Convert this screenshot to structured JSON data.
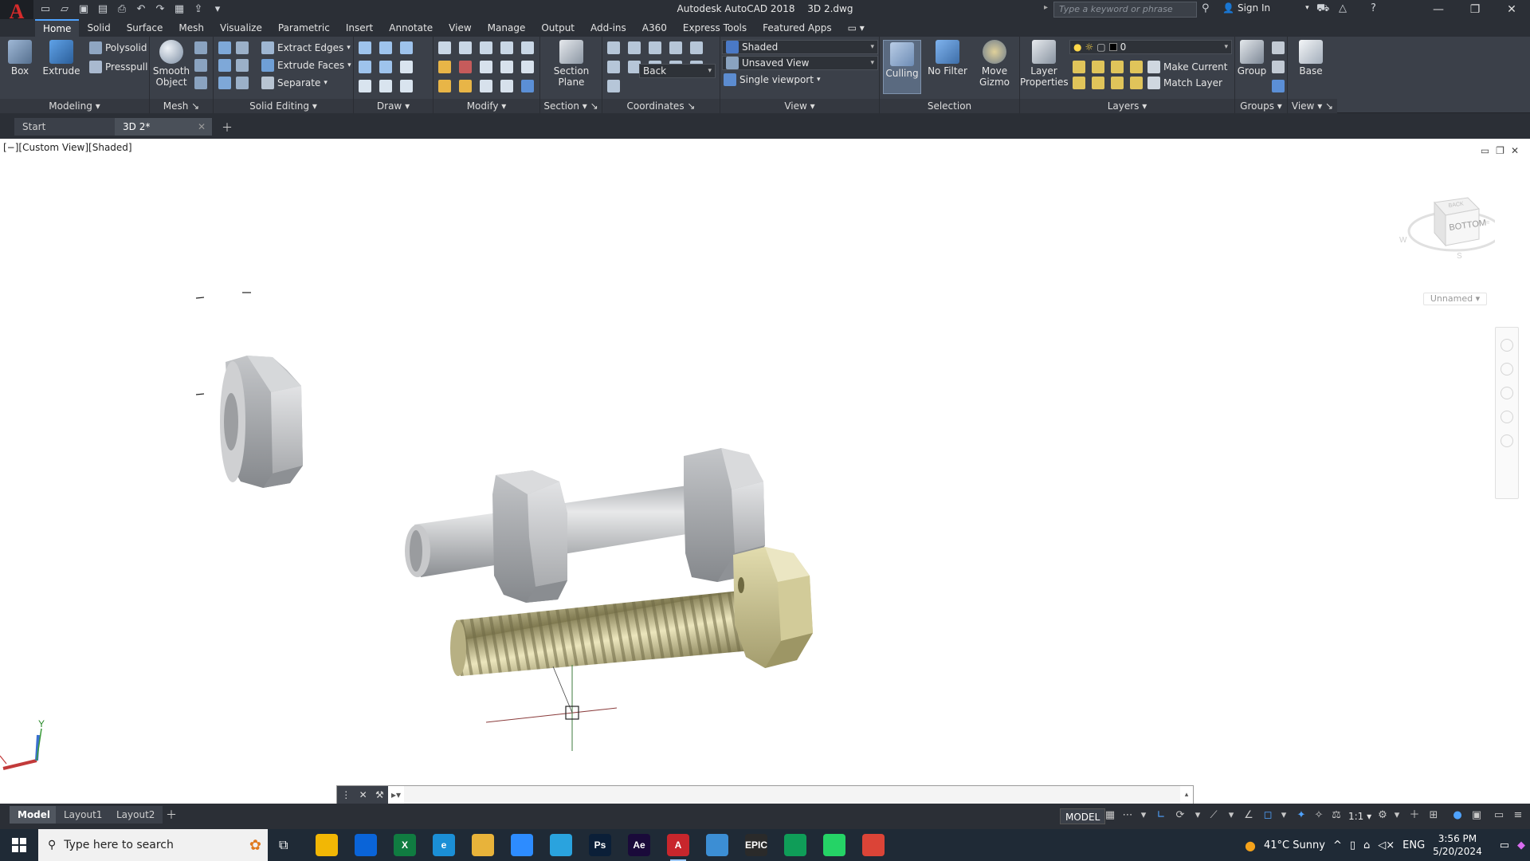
{
  "window": {
    "app_name": "Autodesk AutoCAD 2018",
    "file_name": "3D 2.dwg",
    "search_placeholder": "Type a keyword or phrase",
    "sign_in": "Sign In"
  },
  "ribbon_tabs": [
    "Home",
    "Solid",
    "Surface",
    "Mesh",
    "Visualize",
    "Parametric",
    "Insert",
    "Annotate",
    "View",
    "Manage",
    "Output",
    "Add-ins",
    "A360",
    "Express Tools",
    "Featured Apps"
  ],
  "ribbon": {
    "modeling": {
      "title": "Modeling",
      "box": "Box",
      "extrude": "Extrude",
      "polysolid": "Polysolid",
      "presspull": "Presspull"
    },
    "mesh": {
      "title": "Mesh",
      "smooth_object_1": "Smooth",
      "smooth_object_2": "Object"
    },
    "solid_editing": {
      "title": "Solid Editing",
      "extract_edges": "Extract Edges",
      "extrude_faces": "Extrude Faces",
      "separate": "Separate"
    },
    "draw": {
      "title": "Draw"
    },
    "modify": {
      "title": "Modify"
    },
    "section": {
      "title": "Section",
      "section_plane_1": "Section",
      "section_plane_2": "Plane"
    },
    "coordinates": {
      "title": "Coordinates",
      "ucs_named": "Back"
    },
    "view": {
      "title": "View",
      "visual_style": "Shaded",
      "saved_view": "Unsaved View",
      "viewport": "Single viewport"
    },
    "selection": {
      "title": "Selection",
      "culling": "Culling",
      "no_filter": "No Filter",
      "move_gizmo_1": "Move",
      "move_gizmo_2": "Gizmo"
    },
    "layers": {
      "title": "Layers",
      "layer_properties_1": "Layer",
      "layer_properties_2": "Properties",
      "current_layer": "0",
      "make_current": "Make Current",
      "match_layer": "Match Layer"
    },
    "groups": {
      "title": "Groups",
      "group": "Group"
    },
    "view2": {
      "title": "View",
      "base": "Base"
    }
  },
  "file_tabs": [
    {
      "label": "Start"
    },
    {
      "label": "3D 2*"
    }
  ],
  "viewport": {
    "label": "[−][Custom View][Shaded]",
    "viewcube_face": "BOTTOM",
    "viewcube_top": "BACK",
    "ucs_name": "Unnamed",
    "ucs_axis_y": "Y"
  },
  "layout_tabs": [
    "Model",
    "Layout1",
    "Layout2"
  ],
  "status": {
    "model": "MODEL",
    "scale": "1:1"
  },
  "taskbar": {
    "search_placeholder": "Type here to search",
    "weather": "41°C  Sunny",
    "lang": "ENG",
    "time": "3:56 PM",
    "date": "5/20/2024"
  },
  "apps": [
    {
      "name": "file-explorer-app",
      "label": "",
      "color": "#f2b705"
    },
    {
      "name": "mail-app",
      "label": "",
      "color": "#0a64d8"
    },
    {
      "name": "excel-app",
      "label": "X",
      "color": "#107c41"
    },
    {
      "name": "edge-app",
      "label": "e",
      "color": "#1b8fd6"
    },
    {
      "name": "folder-app",
      "label": "",
      "color": "#e8b33a"
    },
    {
      "name": "zoom-app",
      "label": "",
      "color": "#2d8cff"
    },
    {
      "name": "telegram-app",
      "label": "",
      "color": "#2aa3de"
    },
    {
      "name": "photoshop-app",
      "label": "Ps",
      "color": "#0b1f38"
    },
    {
      "name": "aftereffects-app",
      "label": "Ae",
      "color": "#1a0a3a"
    },
    {
      "name": "autocad-app",
      "label": "A",
      "color": "#c8262c"
    },
    {
      "name": "notepad-app",
      "label": "",
      "color": "#3c8ed4"
    },
    {
      "name": "epic-games-app",
      "label": "EPIC",
      "color": "#2a2a2a"
    },
    {
      "name": "game-app",
      "label": "",
      "color": "#0f9d58"
    },
    {
      "name": "whatsapp-app",
      "label": "",
      "color": "#25d366"
    },
    {
      "name": "chrome-app",
      "label": "",
      "color": "#db4437"
    }
  ],
  "colors": {
    "accent": "#4fa3ff",
    "ribbon_bg": "#3b4049",
    "bolt_gray": "#c4c6c8",
    "bolt_gold": "#c9c391"
  }
}
